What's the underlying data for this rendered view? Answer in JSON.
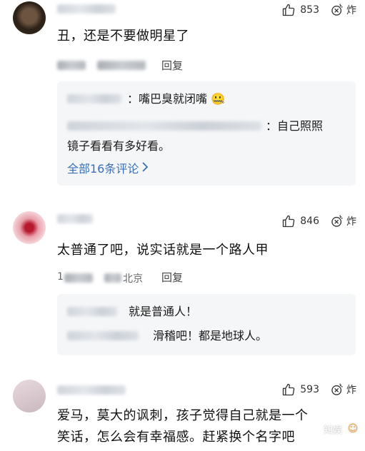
{
  "comments": [
    {
      "text": "丑，还是不要做明星了",
      "likes": "853",
      "shatter_label": "炸",
      "reply_label": "回复",
      "replies": [
        {
          "text": "嘴巴臭就闭嘴",
          "emoji": "🤐"
        },
        {
          "text": "自己照照",
          "text_cont": "镜子看看有多好看。"
        }
      ],
      "more_label": "全部16条评论"
    },
    {
      "text": "太普通了吧，说实话就是一个路人甲",
      "likes": "846",
      "shatter_label": "炸",
      "meta_location": "北京",
      "meta_prefix": "1",
      "reply_label": "回复",
      "replies": [
        {
          "text": "就是普通人！"
        },
        {
          "text": "滑稽吧！都是地球人。"
        }
      ]
    },
    {
      "text_line1": "爱马，莫大的讽刺，孩子觉得自己就是一个",
      "text_line2": "笑话，怎么会有幸福感。赶紧换个名字吧",
      "likes": "593",
      "shatter_label": "炸"
    }
  ],
  "watermark": {
    "label": "知娱",
    "icon": "smile-face-icon"
  },
  "colors": {
    "link": "#3a6fb8",
    "reply_bg": "#f5f6f8"
  }
}
